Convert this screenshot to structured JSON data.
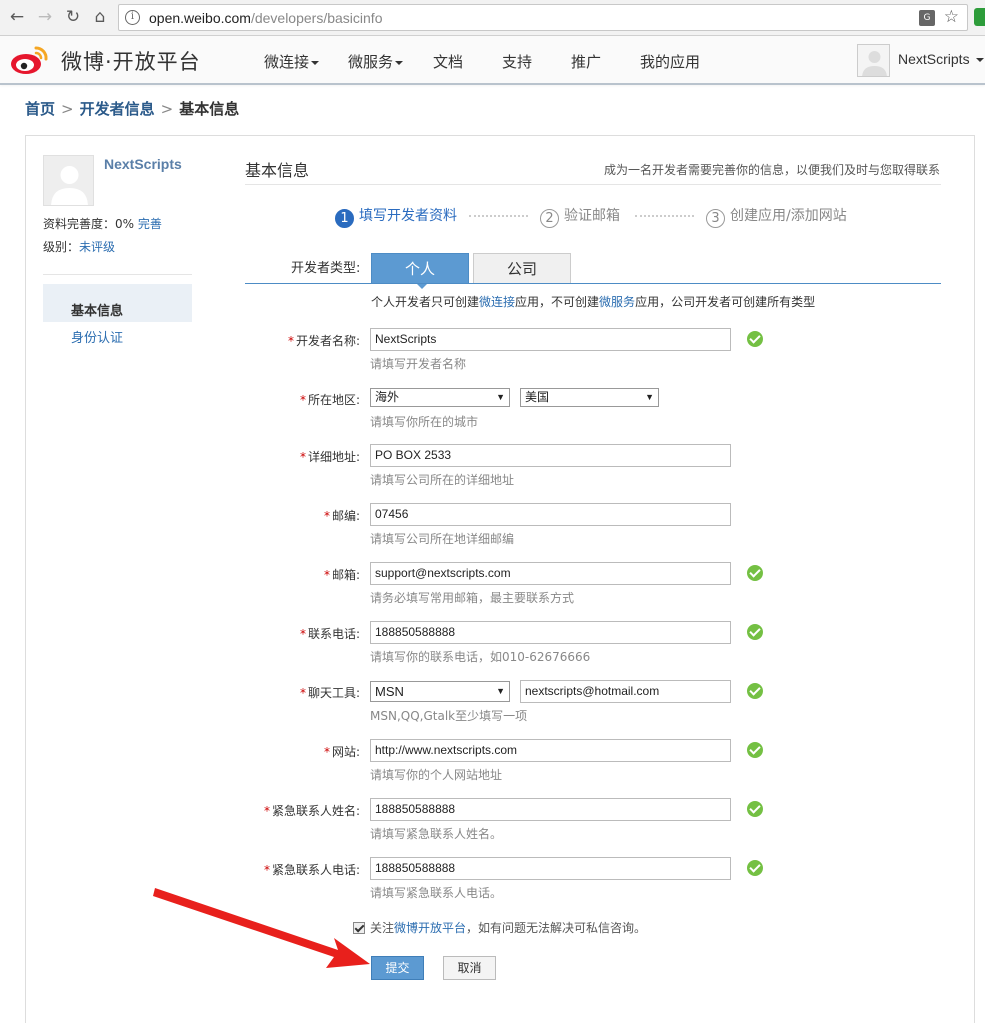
{
  "browser": {
    "url_host": "open.weibo.com",
    "url_path": "/developers/basicinfo"
  },
  "header": {
    "logo_text": "微博·开放平台",
    "menu": [
      {
        "label": "微连接",
        "dropdown": true
      },
      {
        "label": "微服务",
        "dropdown": true
      },
      {
        "label": "文档",
        "dropdown": false
      },
      {
        "label": "支持",
        "dropdown": false
      },
      {
        "label": "推广",
        "dropdown": false
      },
      {
        "label": "我的应用",
        "dropdown": false
      }
    ],
    "user_name": "NextScripts"
  },
  "breadcrumb": {
    "home": "首页",
    "dev_info": "开发者信息",
    "current": "基本信息",
    "sep": ">"
  },
  "sidebar": {
    "user_name": "NextScripts",
    "completion_label": "资料完善度：0%",
    "completion_link": "完善",
    "level_label": "级别：",
    "level_value": "未评级",
    "items": [
      {
        "label": "基本信息",
        "active": true
      },
      {
        "label": "身份认证",
        "active": false
      }
    ]
  },
  "content": {
    "title": "基本信息",
    "note": "成为一名开发者需要完善你的信息，以便我们及时与您取得联系",
    "steps": [
      {
        "num": "1",
        "label": "填写开发者资料",
        "active": true
      },
      {
        "num": "2",
        "label": "验证邮箱",
        "active": false
      },
      {
        "num": "3",
        "label": "创建应用/添加网站",
        "active": false
      }
    ],
    "type_label": "开发者类型:",
    "type_tabs": [
      {
        "label": "个人",
        "active": true
      },
      {
        "label": "公司",
        "active": false
      }
    ],
    "type_hint_1": "个人开发者只可创建",
    "type_hint_link_1": "微连接",
    "type_hint_2": "应用，不可创建",
    "type_hint_link_2": "微服务",
    "type_hint_3": "应用，公司开发者可创建所有类型"
  },
  "form": {
    "name": {
      "label": "开发者名称:",
      "value": "NextScripts",
      "hint": "请填写开发者名称",
      "valid": true
    },
    "region": {
      "label": "所在地区:",
      "value1": "海外",
      "value2": "美国",
      "hint": "请填写你所在的城市"
    },
    "address": {
      "label": "详细地址:",
      "value": "PO BOX 2533",
      "hint": "请填写公司所在的详细地址"
    },
    "zip": {
      "label": "邮编:",
      "value": "07456",
      "hint": "请填写公司所在地详细邮编"
    },
    "email": {
      "label": "邮箱:",
      "value": "support@nextscripts.com",
      "hint": "请务必填写常用邮箱，最主要联系方式",
      "valid": true
    },
    "phone": {
      "label": "联系电话:",
      "value": "188850588888",
      "hint": "请填写你的联系电话，如010-62676666",
      "valid": true
    },
    "im": {
      "label": "聊天工具:",
      "tool": "MSN",
      "value": "nextscripts@hotmail.com",
      "hint": "MSN,QQ,Gtalk至少填写一项",
      "valid": true
    },
    "website": {
      "label": "网站:",
      "value": "http://www.nextscripts.com",
      "hint": "请填写你的个人网站地址",
      "valid": true
    },
    "emergency_name": {
      "label": "紧急联系人姓名:",
      "value": "188850588888",
      "hint": "请填写紧急联系人姓名。",
      "valid": true
    },
    "emergency_phone": {
      "label": "紧急联系人电话:",
      "value": "188850588888",
      "hint": "请填写紧急联系人电话。",
      "valid": true
    },
    "required_mark": "*",
    "follow_prefix": "关注",
    "follow_link": "微博开放平台",
    "follow_suffix": "，如有问题无法解决可私信咨询。",
    "follow_checked": true,
    "submit_label": "提交",
    "cancel_label": "取消"
  },
  "colors": {
    "accent": "#5c9ad2",
    "link": "#2b6db0",
    "valid": "#74c043",
    "arrow": "#e8201c"
  }
}
